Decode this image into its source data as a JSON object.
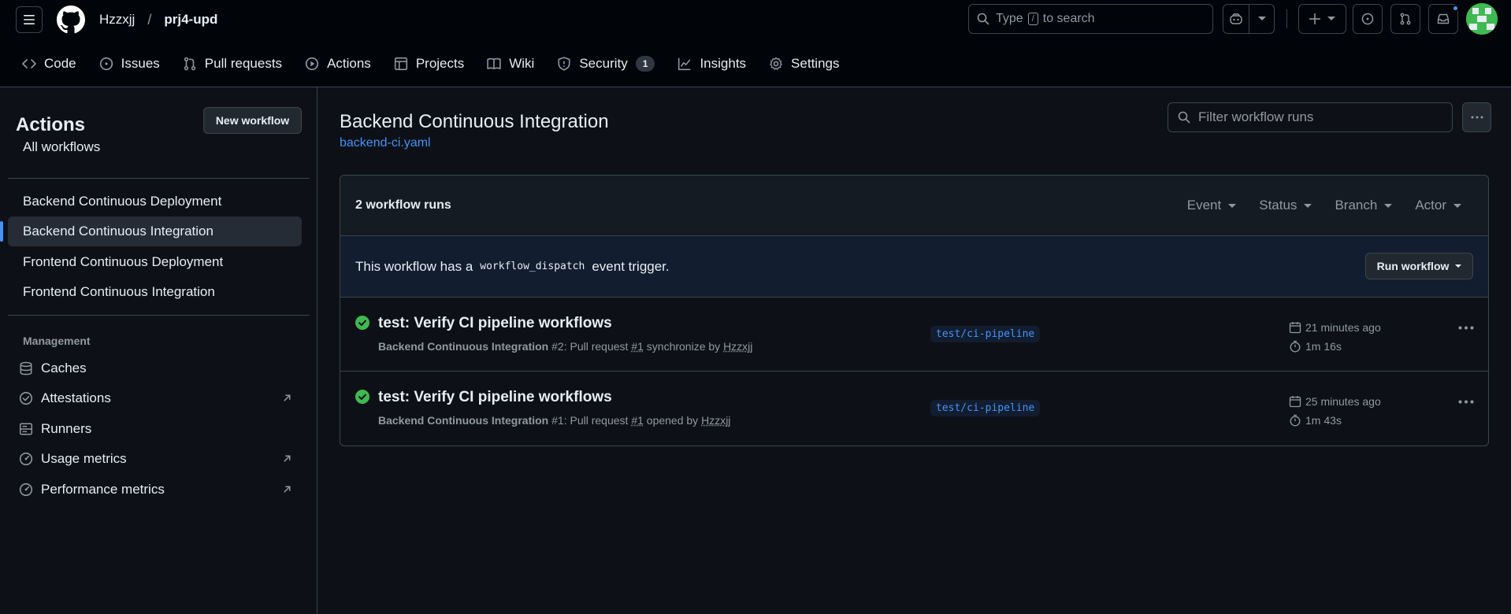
{
  "repo": {
    "owner": "Hzzxjj",
    "separator": "/",
    "name": "prj4-upd"
  },
  "search": {
    "prefix": "Type",
    "key": "/",
    "suffix": "to search"
  },
  "colors": {
    "accent": "#4493f8",
    "success": "#3fb950",
    "bg": "#0d1117",
    "border": "#3d444d"
  },
  "tabs": [
    {
      "label": "Code",
      "icon": "code-icon"
    },
    {
      "label": "Issues",
      "icon": "issue-icon"
    },
    {
      "label": "Pull requests",
      "icon": "pull-request-icon"
    },
    {
      "label": "Actions",
      "icon": "play-icon"
    },
    {
      "label": "Projects",
      "icon": "table-icon"
    },
    {
      "label": "Wiki",
      "icon": "book-icon"
    },
    {
      "label": "Security",
      "icon": "shield-icon",
      "counter": "1"
    },
    {
      "label": "Insights",
      "icon": "graph-icon"
    },
    {
      "label": "Settings",
      "icon": "gear-icon"
    }
  ],
  "sidebar": {
    "title": "Actions",
    "new_workflow": "New workflow",
    "all_workflows": "All workflows",
    "workflows": [
      "Backend Continuous Deployment",
      "Backend Continuous Integration",
      "Frontend Continuous Deployment",
      "Frontend Continuous Integration"
    ],
    "management_heading": "Management",
    "management": [
      {
        "label": "Caches",
        "icon": "database-icon"
      },
      {
        "label": "Attestations",
        "icon": "verified-icon"
      },
      {
        "label": "Runners",
        "icon": "server-icon"
      },
      {
        "label": "Usage metrics",
        "icon": "meter-icon"
      },
      {
        "label": "Performance metrics",
        "icon": "meter-icon"
      }
    ]
  },
  "main": {
    "title": "Backend Continuous Integration",
    "file": "backend-ci.yaml",
    "filter_placeholder": "Filter workflow runs",
    "runs_count": "2 workflow runs",
    "filters": [
      "Event",
      "Status",
      "Branch",
      "Actor"
    ],
    "dispatch": {
      "before": "This workflow has a",
      "code": "workflow_dispatch",
      "after": "event trigger."
    },
    "run_workflow": "Run workflow",
    "runs": [
      {
        "title": "test: Verify CI pipeline workflows",
        "workflow": "Backend Continuous Integration",
        "number": "#2",
        "pr_text": ": Pull request",
        "pr": "#1",
        "action": "synchronize by",
        "user": "Hzzxjj",
        "branch": "test/ci-pipeline",
        "when": "21 minutes ago",
        "duration": "1m 16s"
      },
      {
        "title": "test: Verify CI pipeline workflows",
        "workflow": "Backend Continuous Integration",
        "number": "#1",
        "pr_text": ": Pull request",
        "pr": "#1",
        "action": "opened by",
        "user": "Hzzxjj",
        "branch": "test/ci-pipeline",
        "when": "25 minutes ago",
        "duration": "1m 43s"
      }
    ]
  }
}
